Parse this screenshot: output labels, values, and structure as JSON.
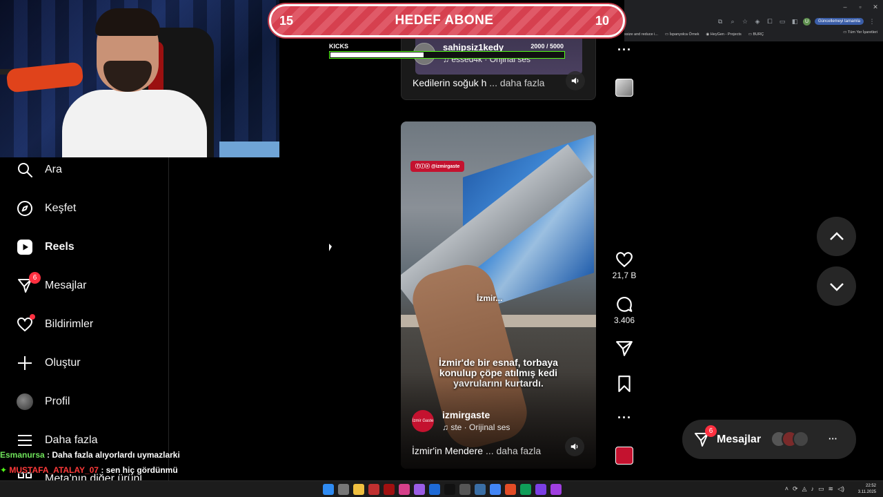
{
  "browser": {
    "update_label": "Güncellemeyi tamamla",
    "bookmarks": [
      "ssize and reduce i...",
      "İspanyolca Örnek",
      "HeyGen - Projects",
      "BURÇ"
    ],
    "all_bookmarks": "Tüm Yer İşaretleri",
    "profile_initial": "U",
    "window_controls": [
      "–",
      "▫",
      "✕"
    ]
  },
  "goal": {
    "left": "15",
    "title": "HEDEF ABONE",
    "right": "10"
  },
  "kicks": {
    "label": "KICKS",
    "value": "2000",
    "separator": " / ",
    "target": "5000",
    "fraction": 0.4
  },
  "sidebar": {
    "items": [
      {
        "label": "Ara",
        "icon": "search-icon"
      },
      {
        "label": "Keşfet",
        "icon": "compass-icon"
      },
      {
        "label": "Reels",
        "icon": "reels-icon"
      },
      {
        "label": "Mesajlar",
        "icon": "messenger-icon",
        "badge": "6"
      },
      {
        "label": "Bildirimler",
        "icon": "heart-icon"
      },
      {
        "label": "Oluştur",
        "icon": "plus-icon"
      },
      {
        "label": "Profil",
        "icon": "avatar"
      },
      {
        "label": "Daha fazla",
        "icon": "menu-icon"
      },
      {
        "label": "Meta'nın diğer ürünl",
        "icon": "meta-icon"
      }
    ]
  },
  "chat": [
    {
      "user": "Esmanursa",
      "sep": " : ",
      "text": "Daha fazla alıyorlardı uymazlarki"
    },
    {
      "user": "MUSTAFA_ATALAY_07",
      "sep": " : ",
      "text": "sen hiç gördünmü"
    }
  ],
  "reel_prev": {
    "username": "sahipsiz1kedy",
    "audio": "essed4k · Orijinal ses",
    "caption": "Kedilerin soğuk h",
    "more": "... daha fazla"
  },
  "reel": {
    "tag": "ⓕⓘⓧ @izmirgaste",
    "watermark": "İzmir...",
    "overlay_text": "İzmir'de bir esnaf, torbaya konulup çöpe atılmış kedi yavrularını kurtardı.",
    "username": "izmirgaste",
    "pfp_text": "İzmir Gaste",
    "audio": "ste · Orijinal ses",
    "caption": "İzmir'in Mendere",
    "more": "... daha fazla",
    "likes": "21,7 B",
    "comments": "3.406"
  },
  "messages_pill": {
    "label": "Mesajlar",
    "badge": "6"
  },
  "clock": {
    "time": "22:52",
    "date": "3.11.2025"
  },
  "colors": {
    "accent_red": "#ff3040",
    "kick_green": "#53fc18",
    "panel": "#262626"
  }
}
